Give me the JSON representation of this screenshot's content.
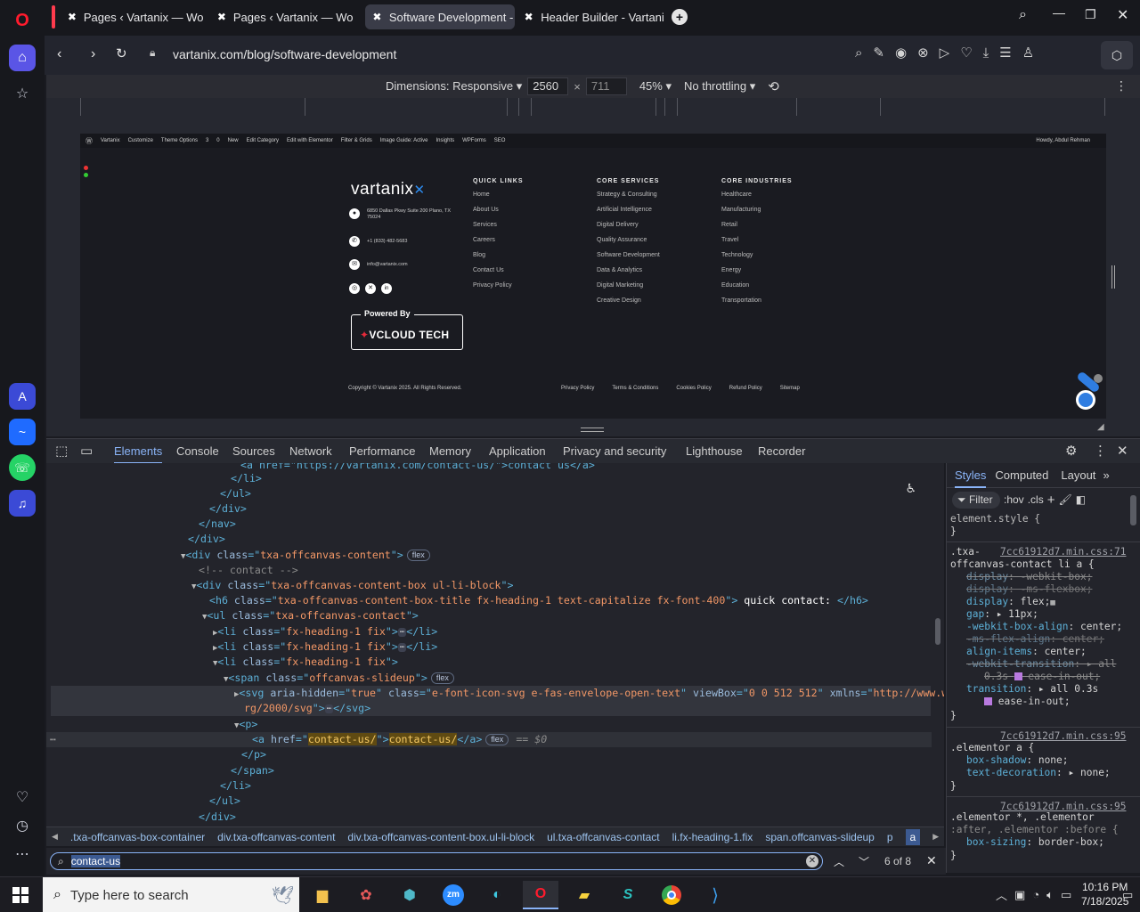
{
  "tabs": [
    {
      "label": "Pages ‹ Vartanix — WordP",
      "icon": "wordpress-icon",
      "active": false
    },
    {
      "label": "Pages ‹ Vartanix — WordP",
      "icon": "wordpress-icon",
      "active": false
    },
    {
      "label": "Software Development - V",
      "icon": "vartanix-icon",
      "active": true
    },
    {
      "label": "Header Builder - Vartanix",
      "icon": "vartanix-icon",
      "active": false
    }
  ],
  "address": {
    "url": "vartanix.com/blog/software-development"
  },
  "device_toolbar": {
    "dimensions_label": "Dimensions: Responsive",
    "width": "2560",
    "height": "711",
    "zoom": "45%",
    "throttling": "No throttling"
  },
  "site": {
    "admin_bar": [
      "Vartanix",
      "Customize",
      "Theme Options",
      "3",
      "0",
      "New",
      "Edit Category",
      "Edit with Elementor",
      "Filter & Grids",
      "Image Guide: Active",
      "Insights",
      "WPForms",
      "SEO"
    ],
    "admin_greeting": "Howdy, Abdul Rehman",
    "logo": "vartanix",
    "address": "6850 Dallas Pkwy Suite 200 Plano, TX 75024",
    "phone": "+1 (833) 482-5683",
    "email": "info@vartanix.com",
    "columns": [
      {
        "title": "QUICK LINKS",
        "links": [
          "Home",
          "About Us",
          "Services",
          "Careers",
          "Blog",
          "Contact Us",
          "Privacy Policy"
        ]
      },
      {
        "title": "CORE SERVICES",
        "links": [
          "Strategy & Consulting",
          "Artificial Intelligence",
          "Digital Delivery",
          "Quality Assurance",
          "Software Development",
          "Data & Analytics",
          "Digital Marketing",
          "Creative Design"
        ]
      },
      {
        "title": "CORE INDUSTRIES",
        "links": [
          "Healthcare",
          "Manufacturing",
          "Retail",
          "Travel",
          "Technology",
          "Energy",
          "Education",
          "Transportation"
        ]
      }
    ],
    "powered_by": "Powered By",
    "powered_brand": "VCLOUD TECH",
    "copyright": "Copyright © Vartanix 2025. All Rights Reserved.",
    "bottom_links": [
      "Privacy Policy",
      "Terms & Conditions",
      "Cookies Policy",
      "Refund Policy",
      "Sitemap"
    ]
  },
  "devtools": {
    "tabs": [
      "Elements",
      "Console",
      "Sources",
      "Network",
      "Performance",
      "Memory",
      "Application",
      "Privacy and security",
      "Lighthouse",
      "Recorder"
    ],
    "style_tabs": [
      "Styles",
      "Computed",
      "Layout"
    ],
    "filter_placeholder": "Filter",
    "hov": ":hov",
    "cls": ".cls",
    "breadcrumbs": [
      ".txa-offcanvas-box-container",
      "div.txa-offcanvas-content",
      "div.txa-offcanvas-content-box.ul-li-block",
      "ul.txa-offcanvas-contact",
      "li.fx-heading-1.fix",
      "span.offcanvas-slideup",
      "p",
      "a"
    ],
    "find_query": "contact-us",
    "find_count": "6 of 8"
  },
  "code": {
    "l0": "<a href=\"https://vartanix.com/contact-us/\">contact us</a>",
    "div_content_class": "txa-offcanvas-content",
    "comment": "<!-- contact -->",
    "box_class": "txa-offcanvas-content-box  ul-li-block",
    "h6_class": "txa-offcanvas-content-box-title fx-heading-1 text-capitalize fx-font-400",
    "h6_text": " quick contact: ",
    "ul_class": "txa-offcanvas-contact",
    "li_class": "fx-heading-1 fix",
    "span_class": "offcanvas-slideup",
    "svg_hidden": "true",
    "svg_class": "e-font-icon-svg e-fas-envelope-open-text",
    "svg_viewbox": "0 0 512 512",
    "svg_xmlns_1": "http://www.w3.o",
    "svg_xmlns_2": "rg/2000/svg",
    "a_href": "contact-us/",
    "a_text": "contact-us/",
    "flex": "flex",
    "dollar": "== $0"
  },
  "styles": {
    "element_style": "element.style {",
    "r1_src": "7cc61912d7.min.css:71",
    "r1_sel_1": ".txa-",
    "r1_sel_2": "offcanvas-contact li a {",
    "r2_src": "7cc61912d7.min.css:95",
    "r2_sel": ".elementor a {",
    "r3_src": "7cc61912d7.min.css:95",
    "r3_sel_1": ".elementor *, .elementor",
    "r3_sel_2": ":after, .elementor :before {"
  },
  "taskbar": {
    "search_placeholder": "Type here to search",
    "time": "10:16 PM",
    "date": "7/18/2025"
  },
  "colors": {
    "accent": "#8ab4f8",
    "opera_red": "#ff1b2d",
    "site_bg": "#1a1b21"
  }
}
